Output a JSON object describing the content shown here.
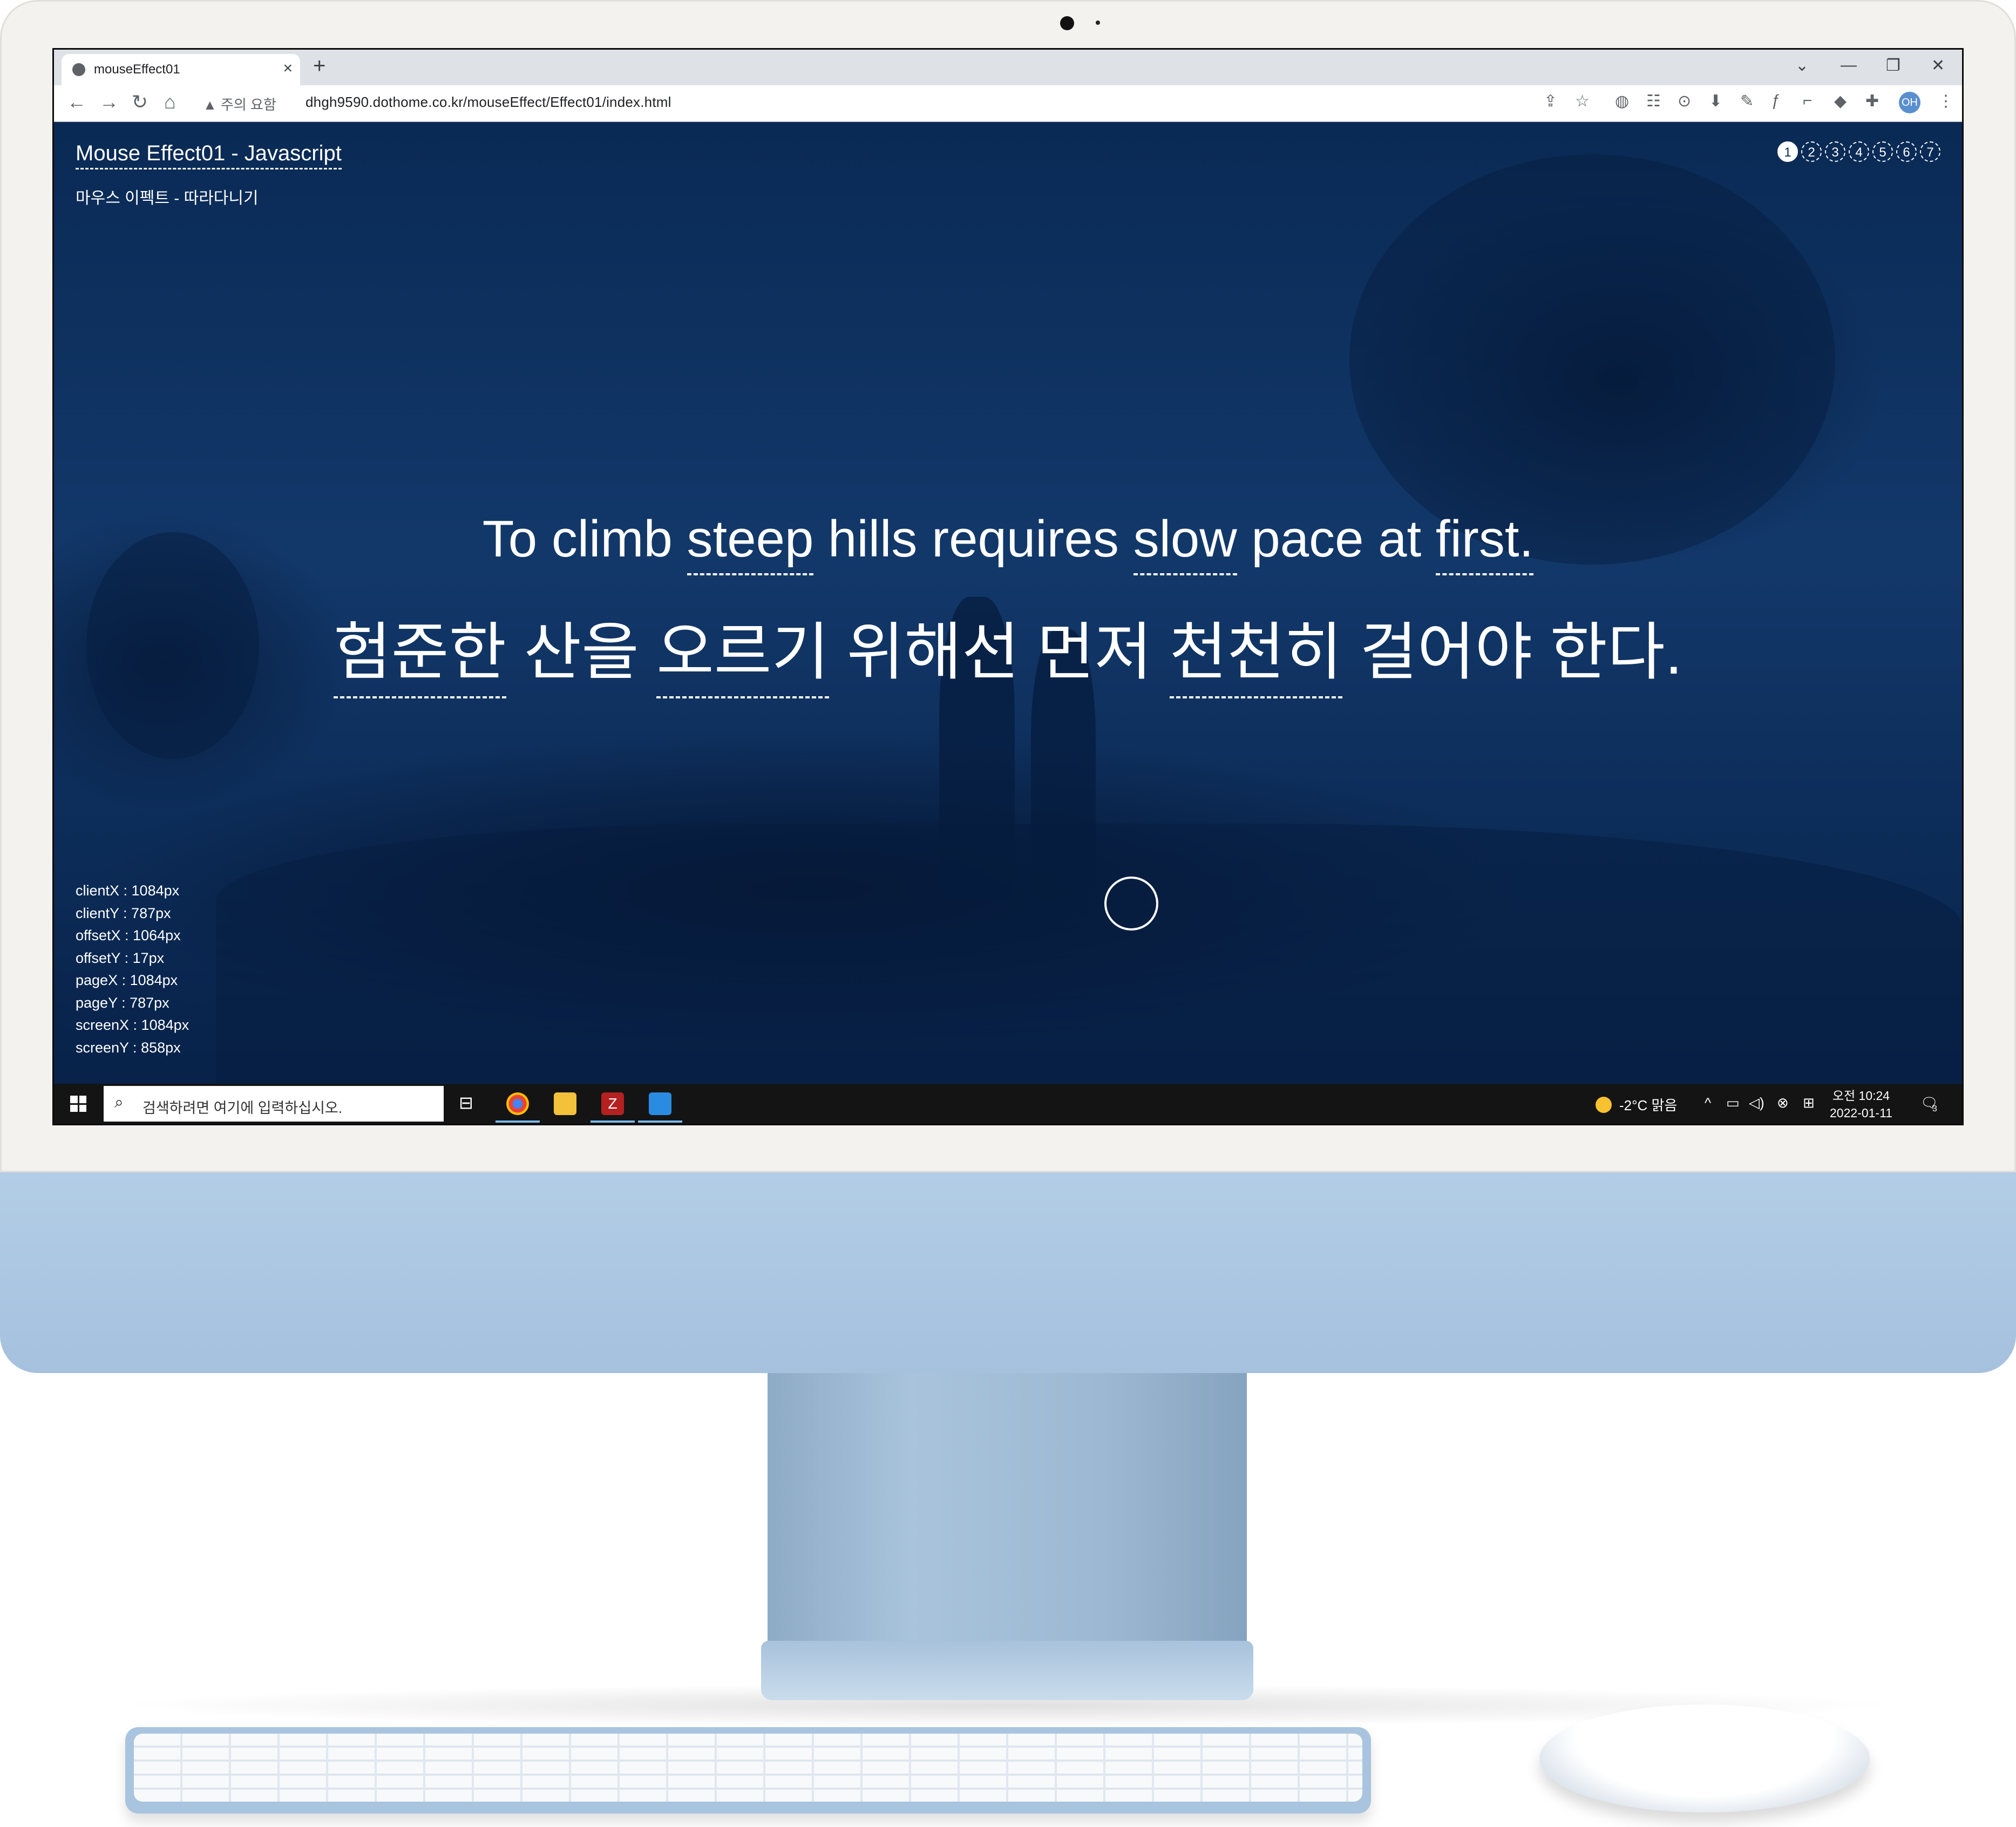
{
  "browser": {
    "tab_title": "mouseEffect01",
    "new_tab_icon": "+",
    "close_tab_icon": "×",
    "security_label": "주의 요함",
    "url": "dhgh9590.dothome.co.kr/mouseEffect/Effect01/index.html",
    "profile_initials": "OH"
  },
  "page": {
    "title": "Mouse Effect01 - Javascript",
    "subtitle": "마우스 이펙트 - 따라다니기",
    "nav_pages": [
      "1",
      "2",
      "3",
      "4",
      "5",
      "6",
      "7"
    ],
    "active_page": "1",
    "quote_en_words": [
      "To climb",
      "steep",
      "hills requires",
      "slow",
      "pace at",
      "first."
    ],
    "quote_ko_words": [
      "험준한",
      "산을",
      "오르기",
      "위해선 먼저",
      "천천히",
      "걸어야 한다."
    ],
    "coords": [
      "clientX : 1084px",
      "clientY : 787px",
      "offsetX : 1064px",
      "offsetY : 17px",
      "pageX : 1084px",
      "pageY : 787px",
      "screenX : 1084px",
      "screenY : 858px"
    ]
  },
  "taskbar": {
    "search_placeholder": "검색하려면 여기에 입력하십시오.",
    "weather": "-2°C 맑음",
    "time": "오전 10:24",
    "date": "2022-01-11",
    "notification_count": "3"
  },
  "colors": {
    "page_background": "#0b2a55",
    "text": "#ffffff",
    "imac_chin": "#a9c4de"
  }
}
